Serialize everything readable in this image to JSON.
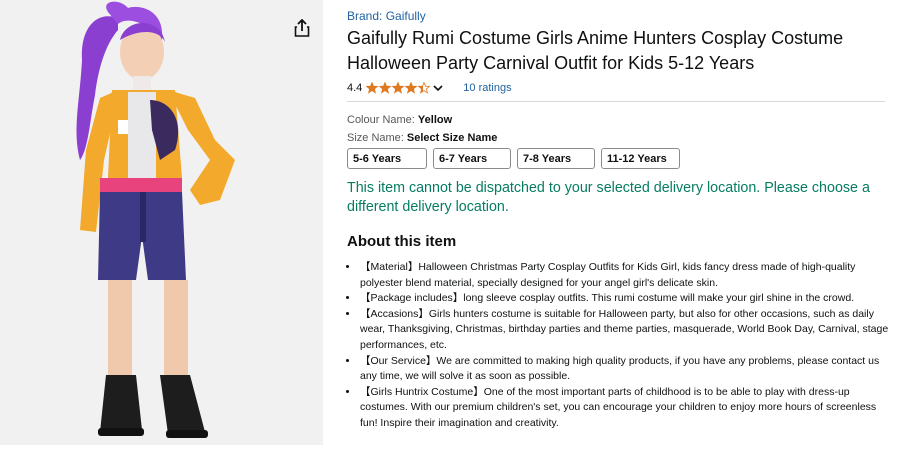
{
  "brand": "Brand: Gaifully",
  "title": "Gaifully Rumi Costume Girls Anime Hunters Cosplay Costume Halloween Party Carnival Outfit for Kids 5-12 Years",
  "rating": {
    "value": "4.4",
    "stars": 4.4,
    "count_label": "10 ratings"
  },
  "colour": {
    "label": "Colour Name: ",
    "value": "Yellow"
  },
  "size": {
    "label": "Size Name: ",
    "value": "Select Size Name",
    "options": [
      "5-6 Years",
      "6-7 Years",
      "7-8 Years",
      "11-12 Years"
    ]
  },
  "warning": "This item cannot be dispatched to your selected delivery location. Please choose a different delivery location.",
  "about_heading": "About this item",
  "bullets": [
    "【Material】Halloween Christmas Party Cosplay Outfits for Kids Girl, kids fancy dress made of high-quality polyester blend material, specially designed for your angel girl's delicate skin.",
    "【Package includes】long sleeve cosplay outfits. This rumi costume will make your girl shine in the crowd.",
    "【Accasions】Girls hunters costume is suitable for Halloween party, but also for other occasions, such as daily wear, Thanksgiving, Christmas, birthday parties and theme parties, masquerade, World Book Day, Carnival, stage performances, etc.",
    "【Our Service】We are committed to making high quality products, if you have any problems, please contact us any time, we will solve it as soon as possible.",
    "【Girls Huntrix Costume】One of the most important parts of childhood is to be able to play with dress-up costumes. With our premium children's set, you can encourage your children to enjoy more hours of screenless fun! Inspire their imagination and creativity."
  ],
  "colors": {
    "link": "#2162a1",
    "star": "#de7921",
    "warning": "#067d62"
  },
  "icons": {
    "share": "share-icon",
    "chevron": "chevron-down-icon"
  }
}
